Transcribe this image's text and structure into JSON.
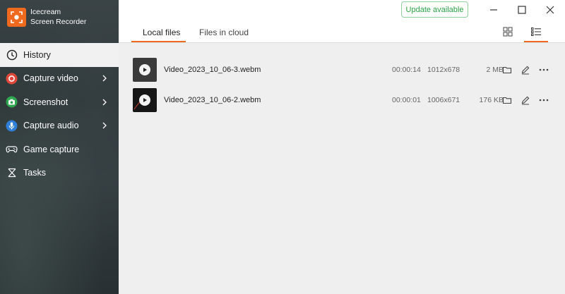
{
  "app": {
    "name_line1": "Icecream",
    "name_line2": "Screen Recorder"
  },
  "sidebar": {
    "items": [
      {
        "label": "History",
        "icon": "clock-icon",
        "active": true
      },
      {
        "label": "Capture video",
        "icon": "record-icon",
        "color": "#e0483a"
      },
      {
        "label": "Screenshot",
        "icon": "camera-icon",
        "color": "#2fa84f"
      },
      {
        "label": "Capture audio",
        "icon": "microphone-icon",
        "color": "#2f7fd8"
      },
      {
        "label": "Game capture",
        "icon": "gamepad-icon"
      },
      {
        "label": "Tasks",
        "icon": "tasks-icon"
      }
    ]
  },
  "header": {
    "update_label": "Update available",
    "tabs": [
      {
        "label": "Local files",
        "active": true
      },
      {
        "label": "Files in cloud",
        "active": false
      }
    ]
  },
  "files": [
    {
      "name": "Video_2023_10_06-3.webm",
      "duration": "00:00:14",
      "resolution": "1012x678",
      "size": "2 MB"
    },
    {
      "name": "Video_2023_10_06-2.webm",
      "duration": "00:00:01",
      "resolution": "1006x671",
      "size": "176 KB"
    }
  ],
  "colors": {
    "accent": "#ef6a1f",
    "update_green": "#2aa243"
  }
}
